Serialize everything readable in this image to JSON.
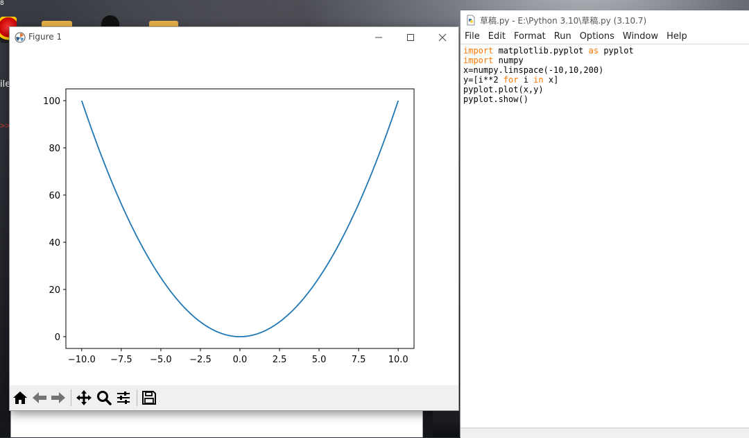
{
  "desktop": {
    "top_fragment": "8",
    "label_fragment": "ile",
    "prompt_fragment": ">>"
  },
  "figure_window": {
    "title": "Figure 1",
    "controls": {
      "minimize": "—",
      "maximize": "☐",
      "close": "✕"
    },
    "toolbar": [
      {
        "name": "home-icon"
      },
      {
        "name": "back-icon"
      },
      {
        "name": "forward-icon"
      },
      {
        "name": "pan-icon"
      },
      {
        "name": "zoom-icon"
      },
      {
        "name": "configure-subplots-icon"
      },
      {
        "name": "save-icon"
      }
    ]
  },
  "chart_data": {
    "type": "line",
    "function": "x**2",
    "series": [
      {
        "color": "#1f77b4",
        "x_start": -10,
        "x_end": 10,
        "num_points": 200
      }
    ],
    "xlim": [
      -11.0,
      11.0
    ],
    "ylim": [
      -5,
      105
    ],
    "xticks": [
      -10.0,
      -7.5,
      -5.0,
      -2.5,
      0.0,
      2.5,
      5.0,
      7.5,
      10.0
    ],
    "xtick_labels": [
      "−10.0",
      "−7.5",
      "−5.0",
      "−2.5",
      "0.0",
      "2.5",
      "5.0",
      "7.5",
      "10.0"
    ],
    "yticks": [
      0,
      20,
      40,
      60,
      80,
      100
    ],
    "ytick_labels": [
      "0",
      "20",
      "40",
      "60",
      "80",
      "100"
    ],
    "grid": false
  },
  "idle_window": {
    "title": "草稿.py - E:\\Python 3.10\\草稿.py (3.10.7)",
    "menu": [
      "File",
      "Edit",
      "Format",
      "Run",
      "Options",
      "Window",
      "Help"
    ],
    "code": [
      [
        {
          "t": "import",
          "k": true
        },
        {
          "t": " matplotlib.pyplot "
        },
        {
          "t": "as",
          "k": true
        },
        {
          "t": " pyplot"
        }
      ],
      [
        {
          "t": "import",
          "k": true
        },
        {
          "t": " numpy"
        }
      ],
      [
        {
          "t": "x=numpy.linspace(-10,10,200)"
        }
      ],
      [
        {
          "t": "y=[i**2 "
        },
        {
          "t": "for",
          "k": true
        },
        {
          "t": " i "
        },
        {
          "t": "in",
          "k": true
        },
        {
          "t": " x]"
        }
      ],
      [
        {
          "t": "pyplot.plot(x,y)"
        }
      ],
      [
        {
          "t": "pyplot.show()"
        }
      ]
    ]
  }
}
